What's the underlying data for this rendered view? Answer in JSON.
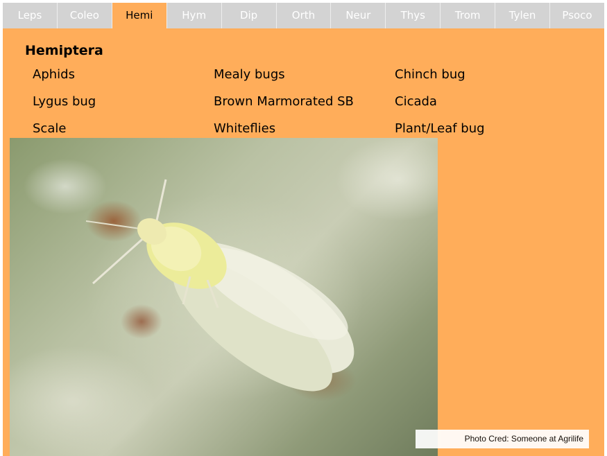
{
  "tabs": [
    {
      "label": "Leps",
      "active": false
    },
    {
      "label": "Coleo",
      "active": false
    },
    {
      "label": "Hemi",
      "active": true
    },
    {
      "label": "Hym",
      "active": false
    },
    {
      "label": "Dip",
      "active": false
    },
    {
      "label": "Orth",
      "active": false
    },
    {
      "label": "Neur",
      "active": false
    },
    {
      "label": "Thys",
      "active": false
    },
    {
      "label": "Trom",
      "active": false
    },
    {
      "label": "Tylen",
      "active": false
    },
    {
      "label": "Psoco",
      "active": false
    }
  ],
  "section": {
    "heading": "Hemiptera",
    "links": [
      "Aphids",
      "Mealy bugs",
      "Chinch bug",
      "Lygus bug",
      "Brown Marmorated SB",
      "Cicada",
      "Scale",
      "Whiteflies",
      "Plant/Leaf bug"
    ]
  },
  "photo": {
    "credit": "Photo Cred: Someone at Agrilife"
  },
  "colors": {
    "panel": "#FFAD5A",
    "tab_inactive": "#d3d3d3",
    "tab_text_inactive": "#ffffff"
  }
}
